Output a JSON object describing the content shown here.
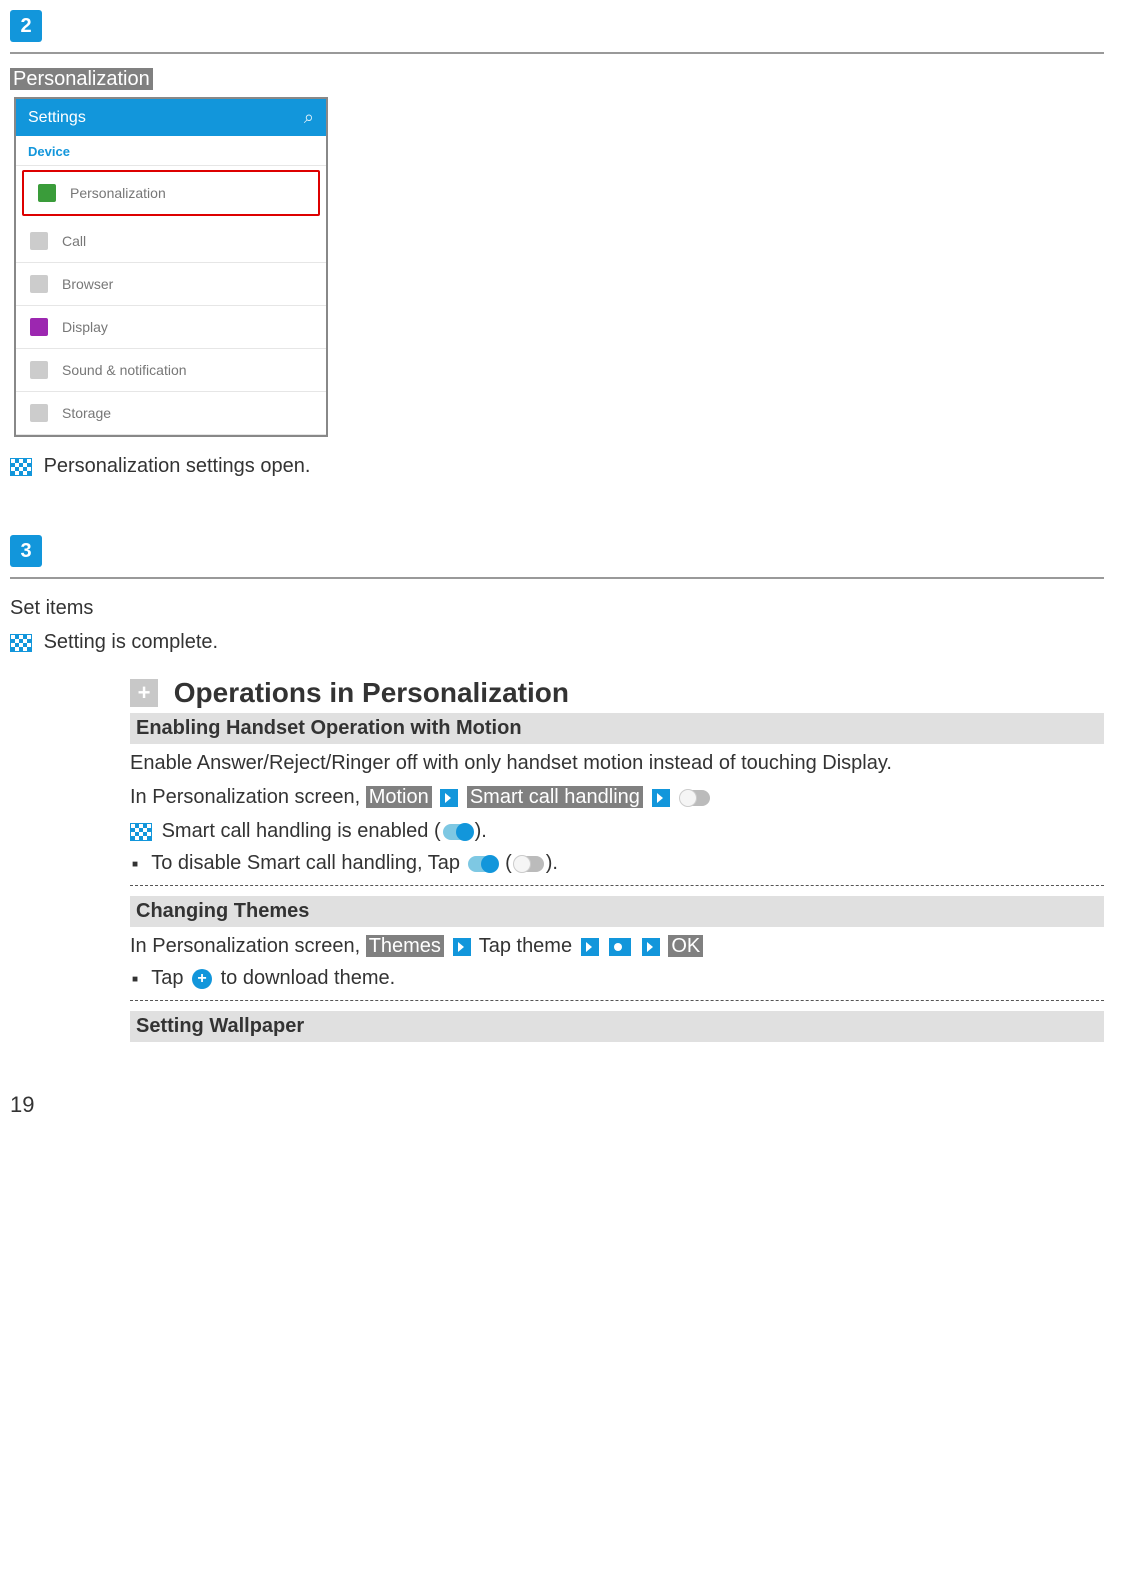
{
  "steps": {
    "badge2": "2",
    "badge3": "3"
  },
  "section2": {
    "title": "Personalization",
    "screenshot": {
      "header": "Settings",
      "tab": "Device",
      "items": [
        {
          "label": "Personalization",
          "selected": true,
          "color": "#3a9c3a"
        },
        {
          "label": "Call",
          "selected": false,
          "color": "#cccccc"
        },
        {
          "label": "Browser",
          "selected": false,
          "color": "#cccccc"
        },
        {
          "label": "Display",
          "selected": false,
          "color": "#9c27b0"
        },
        {
          "label": "Sound & notification",
          "selected": false,
          "color": "#cccccc"
        },
        {
          "label": "Storage",
          "selected": false,
          "color": "#cccccc"
        }
      ]
    },
    "result": "Personalization settings open."
  },
  "section3": {
    "title": "Set items",
    "result": "Setting is complete."
  },
  "ops": {
    "heading": "Operations in Personalization",
    "motion": {
      "heading": "Enabling Handset Operation with Motion",
      "desc": "Enable Answer/Reject/Ringer off with only handset motion instead of touching Display.",
      "line2a": "In Personalization screen, ",
      "chip1": "Motion",
      "chip2": "Smart call handling",
      "resultLine": " Smart call handling is enabled (",
      "resultLineEnd": ").",
      "bullet": "To disable Smart call handling, Tap ",
      "bulletMid": " (",
      "bulletEnd": ")."
    },
    "themes": {
      "heading": "Changing Themes",
      "lineA": "In Personalization screen, ",
      "chip1": "Themes",
      "mid": " Tap theme",
      "chip2": "OK",
      "bullet": "Tap ",
      "bulletEnd": " to download theme."
    },
    "wallpaper": {
      "heading": "Setting Wallpaper"
    }
  },
  "pageNumber": "19"
}
